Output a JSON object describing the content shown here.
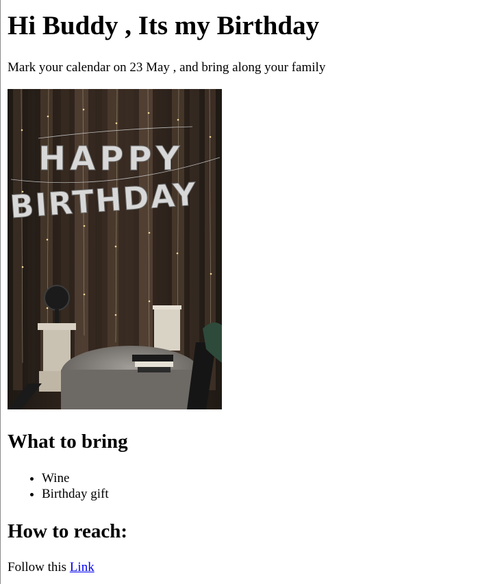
{
  "header": {
    "title": "Hi Buddy , Its my Birthday",
    "subtitle": "Mark your calendar on 23 May , and bring along your family"
  },
  "photo": {
    "banner_top": "HAPPY",
    "banner_bottom": "BIRTHDAY"
  },
  "bring": {
    "heading": "What to bring",
    "items": [
      "Wine",
      "Birthday gift"
    ]
  },
  "reach": {
    "heading": "How to reach:",
    "follow_text": "Follow this ",
    "link_label": "Link"
  },
  "colors": {
    "link": "#0000ee",
    "text": "#000000",
    "background": "#ffffff"
  }
}
